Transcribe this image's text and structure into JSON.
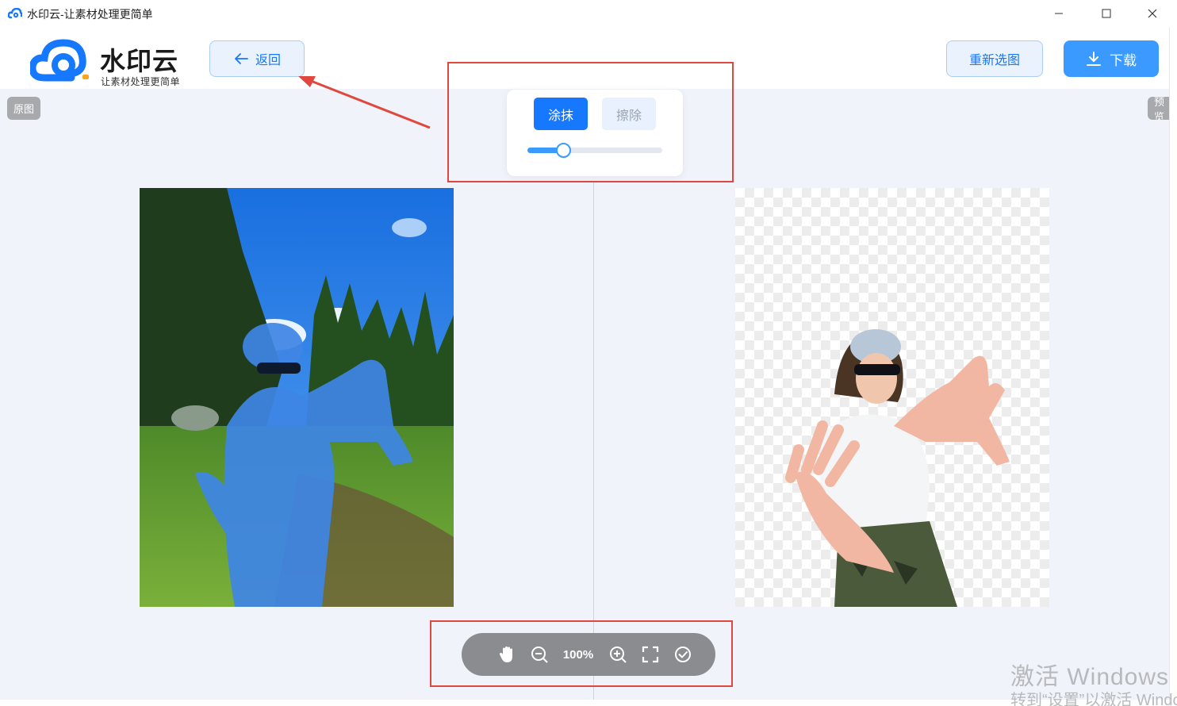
{
  "window": {
    "title": "水印云-让素材处理更简单"
  },
  "header": {
    "brand": "水印云",
    "slogan": "让素材处理更简单",
    "back_label": "返回",
    "reselect_label": "重新选图",
    "download_label": "下载"
  },
  "workspace": {
    "original_tag": "原图",
    "preview_tag": "预览"
  },
  "brush_panel": {
    "paint_label": "涂抹",
    "erase_label": "擦除",
    "brush_size_fraction": 0.27
  },
  "zoom_bar": {
    "zoom": "100%"
  },
  "watermark": {
    "line1": "激活 Windows",
    "line2": "转到“设置”以激活 Windows。"
  },
  "colors": {
    "accent": "#1677ff",
    "annotation": "#e0473e"
  }
}
